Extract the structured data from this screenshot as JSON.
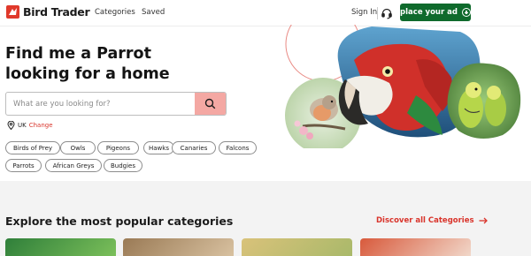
{
  "header": {
    "logo_text": "Bird Trader",
    "nav": [
      {
        "label": "Categories"
      },
      {
        "label": "Saved"
      }
    ],
    "sign_in": "Sign In",
    "support_icon": "headset-icon",
    "place_ad": "place your ad"
  },
  "hero": {
    "title_line1": "Find me a Parrot",
    "title_line2": "looking for a home",
    "search_placeholder": "What are you looking for?",
    "location_country": "UK",
    "location_change": "Change",
    "chips": [
      "Birds of Prey",
      "Owls",
      "Pigeons",
      "Hawks",
      "Canaries",
      "Falcons",
      "Parrots",
      "African Greys",
      "Budgies"
    ]
  },
  "categories": {
    "title": "Explore the most popular categories",
    "discover_link": "Discover all Categories"
  },
  "colors": {
    "brand_red": "#d9342b",
    "ad_green": "#0f6a2c",
    "search_button": "#f4a8a3"
  }
}
